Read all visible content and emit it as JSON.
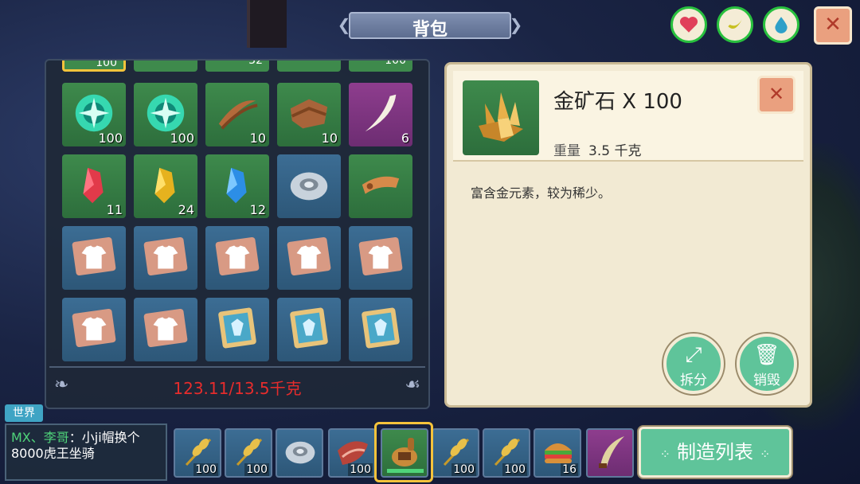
{
  "title": "背包",
  "status": [
    {
      "name": "health",
      "icon": "heart-icon",
      "color": "#e0405a"
    },
    {
      "name": "hunger",
      "icon": "banana-icon",
      "color": "#c8c022"
    },
    {
      "name": "thirst",
      "icon": "water-drop-icon",
      "color": "#2ea0c8"
    }
  ],
  "close_glyph": "✕",
  "inventory": {
    "top_row_qty": [
      "100",
      "",
      "32",
      "",
      "100"
    ],
    "items": [
      {
        "icon": "green-orb-icon",
        "qty": "100",
        "bg": "green"
      },
      {
        "icon": "green-orb-icon",
        "qty": "100",
        "bg": "green"
      },
      {
        "icon": "leather-strap-icon",
        "qty": "10",
        "bg": "green"
      },
      {
        "icon": "leather-hide-icon",
        "qty": "10",
        "bg": "green"
      },
      {
        "icon": "fang-icon",
        "qty": "6",
        "bg": "purple"
      },
      {
        "icon": "red-crystal-icon",
        "qty": "11",
        "bg": "green"
      },
      {
        "icon": "yellow-crystal-icon",
        "qty": "24",
        "bg": "green"
      },
      {
        "icon": "blue-crystal-icon",
        "qty": "12",
        "bg": "green"
      },
      {
        "icon": "stone-disc-icon",
        "qty": "",
        "bg": "blue"
      },
      {
        "icon": "wooden-paddle-icon",
        "qty": "",
        "bg": "green"
      },
      {
        "icon": "shirt-blueprint-icon",
        "qty": "",
        "bg": "blue"
      },
      {
        "icon": "shirt-blueprint-icon",
        "qty": "",
        "bg": "blue"
      },
      {
        "icon": "shirt-blueprint-icon",
        "qty": "",
        "bg": "blue"
      },
      {
        "icon": "shirt-blueprint-icon",
        "qty": "",
        "bg": "blue"
      },
      {
        "icon": "shirt-blueprint-icon",
        "qty": "",
        "bg": "blue"
      },
      {
        "icon": "shirt-blueprint-icon",
        "qty": "",
        "bg": "blue"
      },
      {
        "icon": "shirt-blueprint-icon",
        "qty": "",
        "bg": "blue"
      },
      {
        "icon": "armor-scroll-icon",
        "qty": "",
        "bg": "blue"
      },
      {
        "icon": "armor-scroll-icon",
        "qty": "",
        "bg": "blue"
      },
      {
        "icon": "armor-scroll-icon",
        "qty": "",
        "bg": "blue"
      }
    ],
    "weight": "123.11/13.5千克"
  },
  "detail": {
    "name": "金矿石 X 100",
    "weight_label": "重量",
    "weight_value": "3.5 千克",
    "description": "富含金元素，较为稀少。",
    "split_label": "拆分",
    "destroy_label": "销毁"
  },
  "chat": {
    "channel": "世界",
    "sender": "MX、李哥",
    "message_head": "：小ji帽换个",
    "message_tail": "8000虎王坐骑"
  },
  "hotbar": [
    {
      "icon": "wheat-icon",
      "qty": "100",
      "bg": "blue"
    },
    {
      "icon": "wheat-icon",
      "qty": "100",
      "bg": "blue"
    },
    {
      "icon": "stone-disc-icon",
      "qty": "",
      "bg": "blue"
    },
    {
      "icon": "raw-meat-icon",
      "qty": "100",
      "bg": "blue"
    },
    {
      "icon": "gourd-flask-icon",
      "qty": "",
      "bg": "green"
    },
    {
      "icon": "wheat-icon",
      "qty": "100",
      "bg": "blue"
    },
    {
      "icon": "wheat-icon",
      "qty": "100",
      "bg": "blue"
    },
    {
      "icon": "burger-icon",
      "qty": "16",
      "bg": "blue"
    },
    {
      "icon": "curved-blade-icon",
      "qty": "",
      "bg": "purple"
    }
  ],
  "craft_label": "制造列表"
}
